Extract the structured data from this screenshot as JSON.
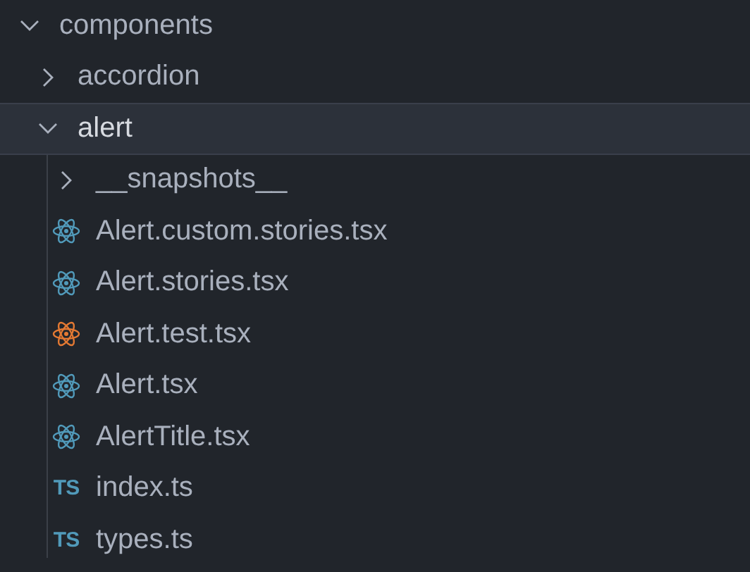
{
  "tree": [
    {
      "kind": "folder",
      "name": "components",
      "expanded": true,
      "selected": false,
      "children": [
        {
          "kind": "folder",
          "name": "accordion",
          "expanded": false,
          "selected": false
        },
        {
          "kind": "folder",
          "name": "alert",
          "expanded": true,
          "selected": true,
          "children": [
            {
              "kind": "folder",
              "name": "__snapshots__",
              "expanded": false,
              "selected": false
            },
            {
              "kind": "react",
              "name": "Alert.custom.stories.tsx",
              "color": "#519aba",
              "selected": false
            },
            {
              "kind": "react",
              "name": "Alert.stories.tsx",
              "color": "#519aba",
              "selected": false
            },
            {
              "kind": "react",
              "name": "Alert.test.tsx",
              "color": "#e37933",
              "selected": false
            },
            {
              "kind": "react",
              "name": "Alert.tsx",
              "color": "#519aba",
              "selected": false
            },
            {
              "kind": "react",
              "name": "AlertTitle.tsx",
              "color": "#519aba",
              "selected": false
            },
            {
              "kind": "ts",
              "badge": "TS",
              "name": "index.ts",
              "color": "#519aba",
              "selected": false
            },
            {
              "kind": "ts",
              "badge": "TS",
              "name": "types.ts",
              "color": "#519aba",
              "selected": false
            }
          ]
        }
      ]
    }
  ]
}
